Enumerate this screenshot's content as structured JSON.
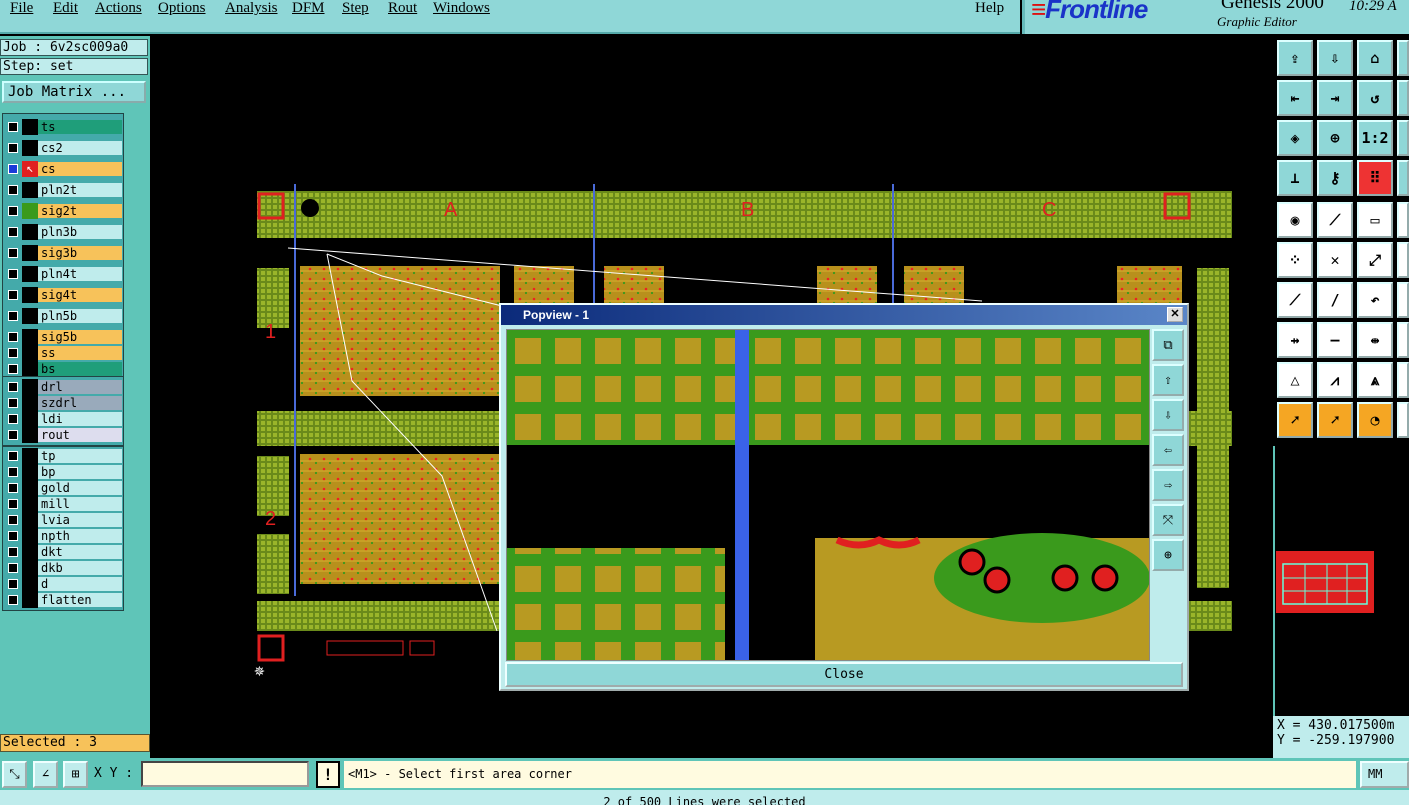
{
  "menu": {
    "items": [
      "File",
      "Edit",
      "Actions",
      "Options",
      "Analysis",
      "DFM",
      "Step",
      "Rout",
      "Windows"
    ],
    "help": "Help"
  },
  "brand": {
    "logo": "Frontline",
    "product": "Genesis 2000",
    "subtitle": "Graphic Editor",
    "time": "10:29 A"
  },
  "job": {
    "job_label": "Job : 6v2sc009a0",
    "step_label": "Step: set",
    "matrix_button": "Job Matrix ..."
  },
  "layers": [
    {
      "name": "ts",
      "color": "#1f9e7a"
    },
    {
      "name": "cs2",
      "color": "#bfecec"
    },
    {
      "name": "cs",
      "color": "#f7c25a",
      "active": true
    },
    {
      "name": "pln2t",
      "color": "#bfecec"
    },
    {
      "name": "sig2t",
      "color": "#f7c25a"
    },
    {
      "name": "pln3b",
      "color": "#bfecec"
    },
    {
      "name": "sig3b",
      "color": "#f7c25a"
    },
    {
      "name": "pln4t",
      "color": "#bfecec"
    },
    {
      "name": "sig4t",
      "color": "#f7c25a"
    },
    {
      "name": "pln5b",
      "color": "#bfecec"
    },
    {
      "name": "sig5b",
      "color": "#f7c25a"
    },
    {
      "name": "ss",
      "color": "#f7c25a"
    },
    {
      "name": "bs",
      "color": "#1f9e7a"
    },
    {
      "name": "drl",
      "color": "#9ab"
    },
    {
      "name": "szdrl",
      "color": "#9ab"
    },
    {
      "name": "ldi",
      "color": "#bfecec"
    },
    {
      "name": "rout",
      "color": "#dde"
    },
    {
      "name": "tp",
      "color": "#bfecec"
    },
    {
      "name": "bp",
      "color": "#bfecec"
    },
    {
      "name": "gold",
      "color": "#bfecec"
    },
    {
      "name": "mill",
      "color": "#bfecec"
    },
    {
      "name": "lvia",
      "color": "#bfecec"
    },
    {
      "name": "npth",
      "color": "#bfecec"
    },
    {
      "name": "dkt",
      "color": "#bfecec"
    },
    {
      "name": "dkb",
      "color": "#bfecec"
    },
    {
      "name": "d",
      "color": "#bfecec"
    },
    {
      "name": "flatten",
      "color": "#bfecec"
    }
  ],
  "selected_label": "Selected : 3",
  "board": {
    "column_labels": [
      "A",
      "B",
      "C"
    ],
    "row_labels": [
      "1",
      "2"
    ]
  },
  "popup": {
    "title": "Popview - 1",
    "close_x": "✕",
    "close_button": "Close"
  },
  "coords": {
    "x": "X = 430.017500m",
    "y": "Y = -259.197900"
  },
  "bottom": {
    "xy_label": "X Y :",
    "xy_value": "",
    "warn": "!",
    "prompt": "<M1> - Select first area corner",
    "units": "MM",
    "status": "2 of 500 Lines were selected"
  },
  "toolbar_icons": [
    "upload-icon",
    "download-icon",
    "home-icon",
    "pan-left-icon",
    "pan-right-icon",
    "undo-icon",
    "fit-icon",
    "center-icon",
    "scale-icon",
    "measure-icon",
    "key-icon",
    "traffic-icon",
    "snap-icon",
    "line-icon",
    "ruler-icon",
    "nodes-icon",
    "cross-icon",
    "route-icon",
    "draw-icon",
    "slash-icon",
    "arc-icon",
    "move-icon",
    "minus-icon",
    "align-icon",
    "triangle-icon",
    "triangle2-icon",
    "triangle3-icon",
    "pointer-icon",
    "pointer2-icon",
    "pointer3-icon"
  ],
  "colors": {
    "panel": "#5fc5b8",
    "pad": "#b8a022",
    "plane": "#3a9a1c",
    "accent": "#e02020"
  }
}
